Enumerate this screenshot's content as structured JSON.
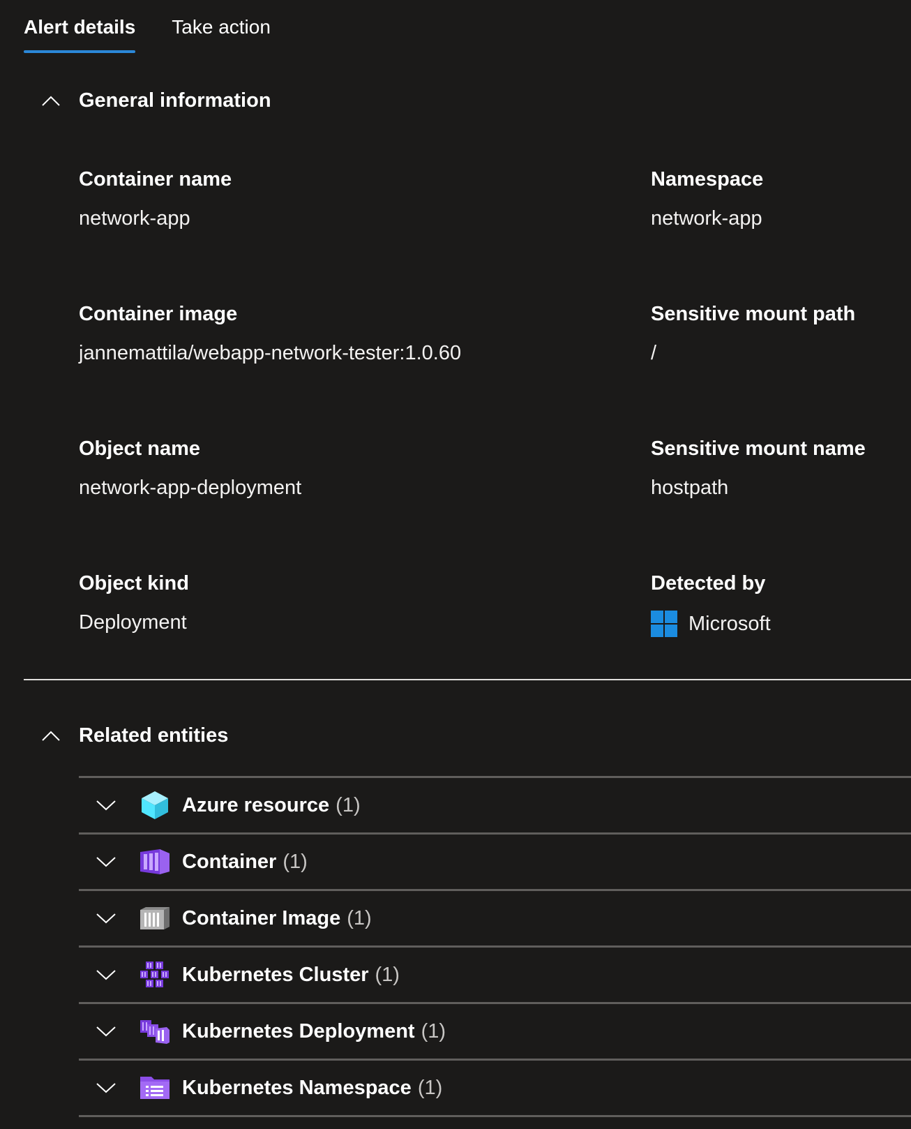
{
  "tabs": [
    {
      "label": "Alert details",
      "active": true
    },
    {
      "label": "Take action",
      "active": false
    }
  ],
  "general": {
    "title": "General information",
    "fields": {
      "container_name": {
        "label": "Container name",
        "value": "network-app"
      },
      "namespace": {
        "label": "Namespace",
        "value": "network-app"
      },
      "container_image": {
        "label": "Container image",
        "value": "jannemattila/webapp-network-tester:1.0.60"
      },
      "sensitive_mount_path": {
        "label": "Sensitive mount path",
        "value": "/"
      },
      "object_name": {
        "label": "Object name",
        "value": "network-app-deployment"
      },
      "sensitive_mount_name": {
        "label": "Sensitive mount name",
        "value": "hostpath"
      },
      "object_kind": {
        "label": "Object kind",
        "value": "Deployment"
      },
      "detected_by": {
        "label": "Detected by",
        "value": "Microsoft",
        "icon": "microsoft-logo-icon"
      }
    }
  },
  "related": {
    "title": "Related entities",
    "items": [
      {
        "name": "Azure resource",
        "count": "(1)",
        "icon": "azure-resource-icon",
        "color": "#50e6ff"
      },
      {
        "name": "Container",
        "count": "(1)",
        "icon": "container-icon",
        "color": "#773adc"
      },
      {
        "name": "Container Image",
        "count": "(1)",
        "icon": "container-image-icon",
        "color": "#a0a0a0"
      },
      {
        "name": "Kubernetes Cluster",
        "count": "(1)",
        "icon": "kubernetes-cluster-icon",
        "color": "#773adc"
      },
      {
        "name": "Kubernetes Deployment",
        "count": "(1)",
        "icon": "kubernetes-deployment-icon",
        "color": "#773adc"
      },
      {
        "name": "Kubernetes Namespace",
        "count": "(1)",
        "icon": "kubernetes-namespace-icon",
        "color": "#8c4ee8"
      }
    ]
  },
  "colors": {
    "background": "#1b1a19",
    "accent": "#2b88d8",
    "microsoft_blue": "#1b8ce0"
  }
}
